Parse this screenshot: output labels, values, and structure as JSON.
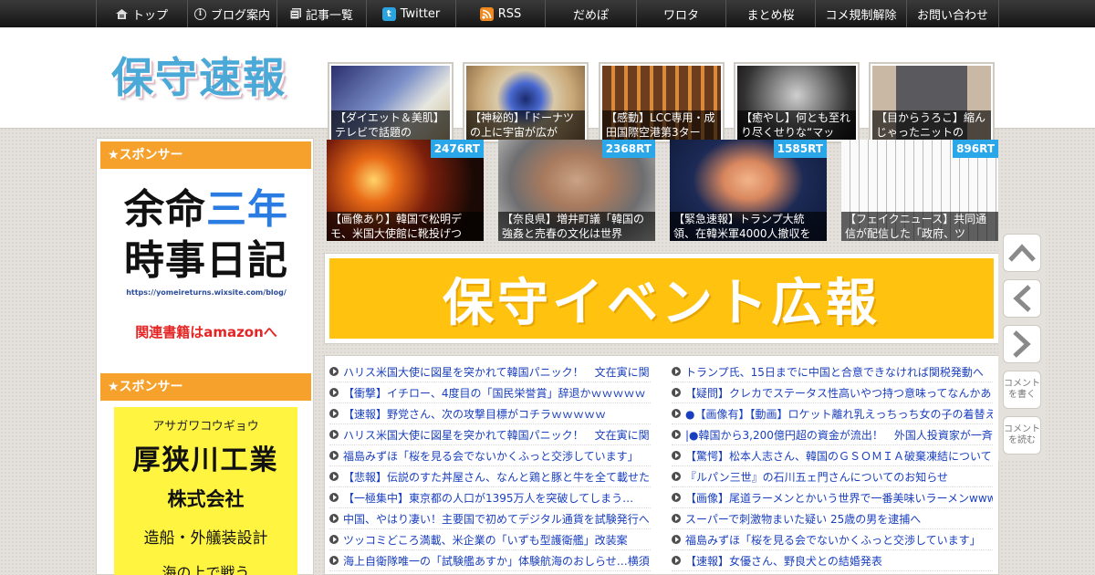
{
  "nav": [
    {
      "label": "トップ",
      "icon": "home-icon"
    },
    {
      "label": "ブログ案内",
      "icon": "info-icon"
    },
    {
      "label": "記事一覧",
      "icon": "list-icon"
    },
    {
      "label": "Twitter",
      "icon": "twitter-icon"
    },
    {
      "label": "RSS",
      "icon": "rss-icon"
    },
    {
      "label": "だめぽ"
    },
    {
      "label": "ワロタ"
    },
    {
      "label": "まとめ桜"
    },
    {
      "label": "コメ規制解除"
    },
    {
      "label": "お問い合わせ"
    }
  ],
  "logo": "保守速報",
  "header_thumbs": [
    {
      "caption": "【ダイエット＆美肌】テレビで話題の"
    },
    {
      "caption": "【神秘的】「ドーナツの上に宇宙が広が"
    },
    {
      "caption": "【感動】LCC専用・成田国際空港第3ター"
    },
    {
      "caption": "【癒やし】何とも至れり尽くせりな“マッ"
    },
    {
      "caption": "【目からうろこ】縮んじゃったニットの"
    }
  ],
  "sidebar": {
    "sponsor_label": "★スポンサー",
    "ad1": {
      "line1": "余命",
      "line1_accent": "三年",
      "line2": "時事日記",
      "url": "https://yomeireturns.wixsite.com/blog/",
      "amazon": "関連書籍はamazonへ"
    },
    "ad2": {
      "kana": "アサガワコウギョウ",
      "name": "厚狭川工業",
      "corp": "株式会社",
      "business": "造船・外艤装設計",
      "more": "海の上で戦う"
    }
  },
  "rt_cards": [
    {
      "badge": "2476RT",
      "caption": "【画像あり】韓国で松明デモ、米国大使館に靴投げつ"
    },
    {
      "badge": "2368RT",
      "caption": "【奈良県】増井町議「韓国の強姦と売春の文化は世界"
    },
    {
      "badge": "1585RT",
      "caption": "【緊急速報】トランプ大統領、在韓米軍4000人撤収を"
    },
    {
      "badge": "896RT",
      "caption": "【フェイクニュース】共同通信が配信した「政府、ツ"
    }
  ],
  "banner": "保守イベント広報",
  "list_left": [
    "ハリス米国大使に図星を突かれて韓国パニック！　文在寅に関",
    "【衝撃】イチロー、4度目の「国民栄誉賞」辞退かｗｗｗｗｗ",
    "【速報】野党さん、次の攻撃目標がコチラｗｗｗｗｗ",
    "ハリス米国大使に図星を突かれて韓国パニック！　文在寅に関",
    "福島みずほ「桜を見る会でないかくふっと交渉しています」",
    "【悲報】伝説のすた丼屋さん、なんと鶏と豚と牛を全て載せた",
    "【一極集中】東京都の人口が1395万人を突破してしまう…",
    "中国、やはり凄い！主要国で初めてデジタル通貨を試験発行へ",
    "ツッコミどころ満載、米企業の「いずも型護衛艦」改装案",
    "海上自衛隊唯一の「試験艦あすか」体験航海のおしらせ…横須"
  ],
  "list_right": [
    "トランプ氏、15日までに中国と合意できなければ関税発動へ",
    "【疑問】クレカでステータス性高いやつ持つ意味ってなんかあ",
    "●【画像有】【動画】ロケット離れ乳えっちっち女の子の着替え",
    "|●韓国から3,200億円超の資金が流出！　外国人投資家が一斉に",
    "【驚愕】松本人志さん、韓国のＧＳＯＭＩＡ破棄凍結について",
    "『ルパン三世』の石川五ェ門さんについてのお知らせ",
    "【画像】尾道ラーメンとかいう世界で一番美味いラーメンwww",
    "スーパーで刺激物まいた疑い 25歳の男を逮捕へ",
    "福島みずほ「桜を見る会でないかくふっと交渉しています」",
    "【速報】女優さん、野良犬との結婚発表"
  ],
  "float_buttons": {
    "comment_write": "コメントを書く",
    "comment_read": "コメントを読む"
  }
}
